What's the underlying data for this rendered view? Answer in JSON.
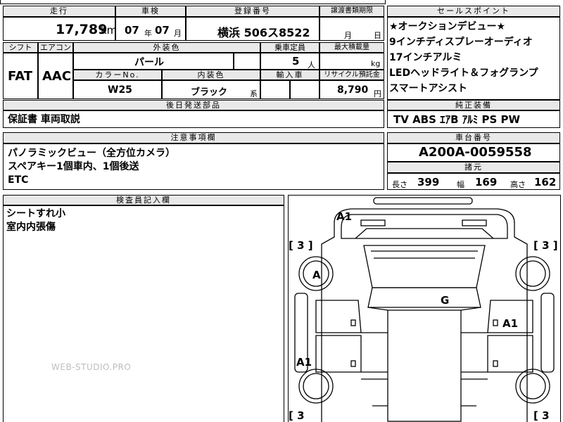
{
  "top": {
    "mileage_label": "走行",
    "mileage_value": "17,789",
    "mileage_unit": "km",
    "inspection_label": "車検",
    "inspection_year": "07",
    "inspection_year_unit": "年",
    "inspection_month": "07",
    "inspection_month_unit": "月",
    "registration_label": "登録番号",
    "registration_value": "横浜 506ス8522",
    "transfer_label": "譲渡書類期限",
    "transfer_month": "月",
    "transfer_day": "日"
  },
  "row2": {
    "shift_label": "シフト",
    "shift_value": "FAT",
    "aircon_label": "エアコン",
    "aircon_value": "AAC",
    "exterior_color_label": "外装色",
    "exterior_color_value": "パール",
    "capacity_label": "乗車定員",
    "capacity_value": "5",
    "capacity_unit": "人",
    "max_load_label": "最大積載量",
    "max_load_unit": "kg",
    "color_no_label": "カラーNo.",
    "color_no_value": "W25",
    "interior_color_label": "内装色",
    "interior_color_value": "ブラック",
    "interior_color_suffix": "系",
    "import_label": "輸入車",
    "recycle_label": "リサイクル預託金",
    "recycle_value": "8,790",
    "recycle_unit": "円"
  },
  "later_parts": {
    "label": "後日発送部品",
    "value": "保証書 車両取説"
  },
  "notes": {
    "label": "注意事項欄",
    "lines": [
      "パノラミックビュー（全方位カメラ）",
      "スペアキー1個車内、1個後送",
      "ETC"
    ]
  },
  "inspector": {
    "label": "検査員記入欄",
    "lines": [
      "シートすれ小",
      "室内内張傷"
    ]
  },
  "sales_points": {
    "label": "セールスポイント",
    "lines": [
      "★オークションデビュー★",
      "9インチディスプレーオーディオ",
      "17インチアルミ",
      "LEDヘッドライト＆フォグランプ",
      "スマートアシスト"
    ]
  },
  "genuine": {
    "label": "純正装備",
    "value": "TV ABS ｴｱB ｱﾙﾐ PS PW"
  },
  "chassis": {
    "label": "車台番号",
    "value": "A200A-0059558"
  },
  "specs": {
    "label": "諸元",
    "length_label": "長さ",
    "length_value": "399",
    "width_label": "幅",
    "width_value": "169",
    "height_label": "高さ",
    "height_value": "162"
  },
  "diagram": {
    "marks": {
      "front_top": "A1",
      "wheel_front_left": "A",
      "roof": "G",
      "right_side": "A1",
      "left_side": "A1"
    },
    "tire_fl": "[ 3 ]",
    "tire_fr": "[ 3 ]",
    "tire_rl": "[ 3",
    "tire_rr": "[ 3"
  },
  "watermark": "WEB-STUDIO.PRO"
}
